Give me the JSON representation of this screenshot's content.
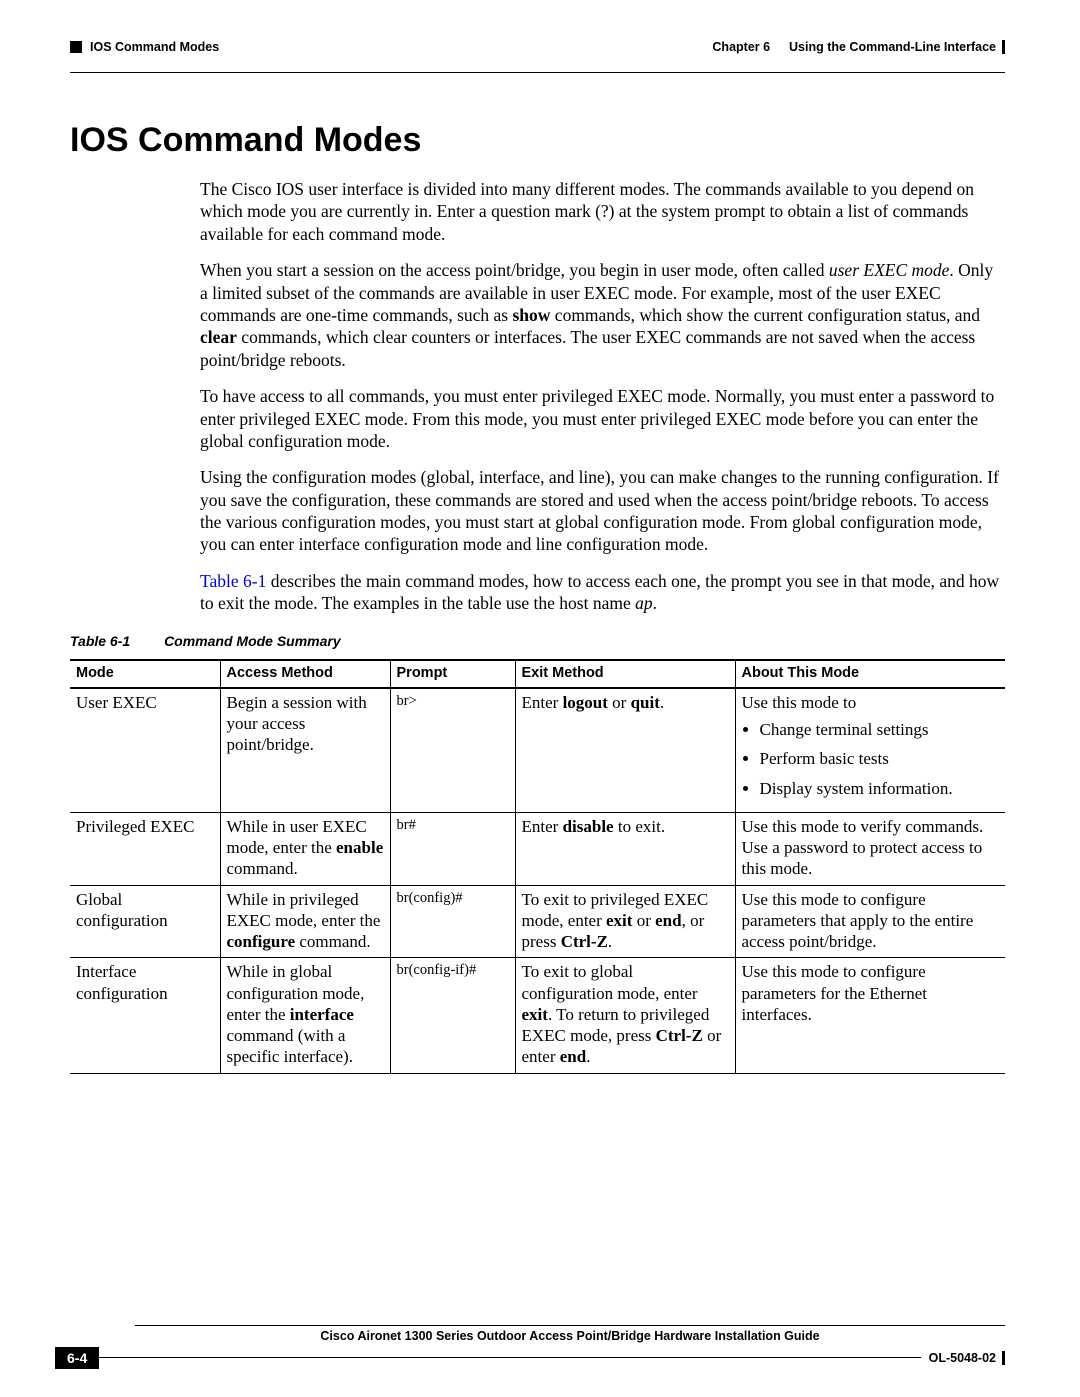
{
  "header": {
    "section_label": "IOS Command Modes",
    "chapter_label": "Chapter 6",
    "chapter_title": "Using the Command-Line Interface"
  },
  "title": "IOS Command Modes",
  "paragraphs": {
    "p1": "The Cisco IOS user interface is divided into many different modes. The commands available to you depend on which mode you are currently in. Enter a question mark (?) at the system prompt to obtain a list of commands available for each command mode.",
    "p2a": "When you start a session on the access point/bridge, you begin in user mode, often called ",
    "p2b": "user EXEC mode",
    "p2c": ". Only a limited subset of the commands are available in user EXEC mode. For example, most of the user EXEC commands are one-time commands, such as ",
    "p2d": "show",
    "p2e": " commands, which show the current configuration status, and ",
    "p2f": "clear",
    "p2g": " commands, which clear counters or interfaces. The user EXEC commands are not saved when the access point/bridge reboots.",
    "p3": "To have access to all commands, you must enter privileged EXEC mode. Normally, you must enter a password to enter privileged EXEC mode. From this mode, you must enter privileged EXEC mode before you can enter the global configuration mode.",
    "p4": "Using the configuration modes (global, interface, and line), you can make changes to the running configuration. If you save the configuration, these commands are stored and used when the access point/bridge reboots. To access the various configuration modes, you must start at global configuration mode. From global configuration mode, you can enter interface configuration mode and line configuration mode.",
    "p5a": "Table 6-1",
    "p5b": " describes the main command modes, how to access each one, the prompt you see in that mode, and how to exit the mode. The examples in the table use the host name ",
    "p5c": "ap",
    "p5d": "."
  },
  "table": {
    "caption_num": "Table 6-1",
    "caption_title": "Command Mode Summary",
    "headers": {
      "mode": "Mode",
      "access": "Access Method",
      "prompt": "Prompt",
      "exit": "Exit Method",
      "about": "About This Mode"
    },
    "rows": [
      {
        "mode": "User EXEC",
        "access": "Begin a session with your access point/bridge.",
        "prompt": "br>",
        "exit_a": "Enter ",
        "exit_b": "logout",
        "exit_c": " or ",
        "exit_d": "quit",
        "exit_e": ".",
        "about": {
          "lead": "Use this mode to",
          "items": [
            "Change terminal settings",
            "Perform basic tests",
            "Display system information."
          ]
        }
      },
      {
        "mode": "Privileged EXEC",
        "access_a": "While in user EXEC mode, enter the ",
        "access_b": "enable",
        "access_c": " command.",
        "prompt": "br#",
        "exit_a": "Enter ",
        "exit_b": "disable",
        "exit_c": " to exit.",
        "about": "Use this mode to verify commands. Use a password to protect access to this mode."
      },
      {
        "mode": "Global configuration",
        "access_a": "While in privileged EXEC mode, enter the ",
        "access_b": "configure",
        "access_c": " command.",
        "prompt": "br(config)#",
        "exit_a": "To exit to privileged EXEC mode, enter ",
        "exit_b": "exit",
        "exit_c": " or ",
        "exit_d": "end",
        "exit_e": ", or press ",
        "exit_f": "Ctrl-Z",
        "exit_g": ".",
        "about": "Use this mode to configure parameters that apply to the entire access point/bridge."
      },
      {
        "mode": "Interface configuration",
        "access_a": "While in global configuration mode, enter the ",
        "access_b": "interface",
        "access_c": " command (with a specific interface).",
        "prompt": "br(config-if)#",
        "exit_a": "To exit to global configuration mode, enter ",
        "exit_b": "exit",
        "exit_c": ". To return to privileged EXEC mode, press ",
        "exit_d": "Ctrl-Z",
        "exit_e": " or enter ",
        "exit_f": "end",
        "exit_g": ".",
        "about": "Use this mode to configure parameters for the Ethernet interfaces."
      }
    ]
  },
  "footer": {
    "guide_title": "Cisco Aironet 1300 Series Outdoor Access Point/Bridge Hardware Installation Guide",
    "page": "6-4",
    "doc_id": "OL-5048-02"
  }
}
